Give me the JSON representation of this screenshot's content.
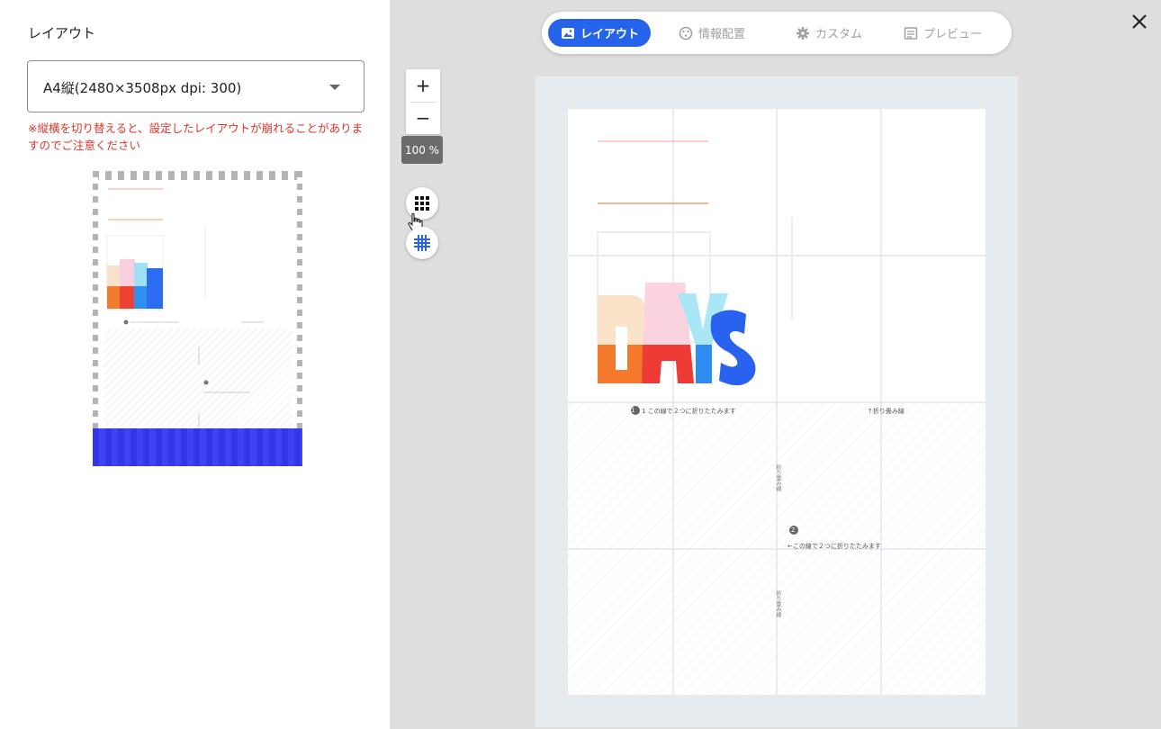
{
  "left_panel": {
    "title": "レイアウト",
    "layout_select": {
      "value": "A4縦(2480×3508px dpi: 300)"
    },
    "warning": "※縦横を切り替えると、設定したレイアウトが崩れることがありますのでご注意ください"
  },
  "mode_tabs": [
    {
      "label": "レイアウト",
      "icon": "image-icon",
      "active": true
    },
    {
      "label": "情報配置",
      "icon": "puzzle-icon",
      "active": false
    },
    {
      "label": "カスタム",
      "icon": "gear-icon",
      "active": false
    },
    {
      "label": "プレビュー",
      "icon": "preview-icon",
      "active": false
    }
  ],
  "zoom": {
    "plus_label": "+",
    "minus_label": "−",
    "level": "100 %"
  },
  "canvas": {
    "fold_line_1": "1 この線で２つに折りたたみます",
    "fold_guide": "↑折り畳み線",
    "fold_line_2": "←この線で２つに折りたたみます",
    "fold_vertical_1": "折り畳み線",
    "fold_vertical_2": "折り畳み線",
    "step_1": "1",
    "step_2": "2",
    "artwork_text": "DAYS"
  },
  "colors": {
    "accent": "#2563eb",
    "warning": "#e0332a",
    "band": "#3b3ff0"
  }
}
